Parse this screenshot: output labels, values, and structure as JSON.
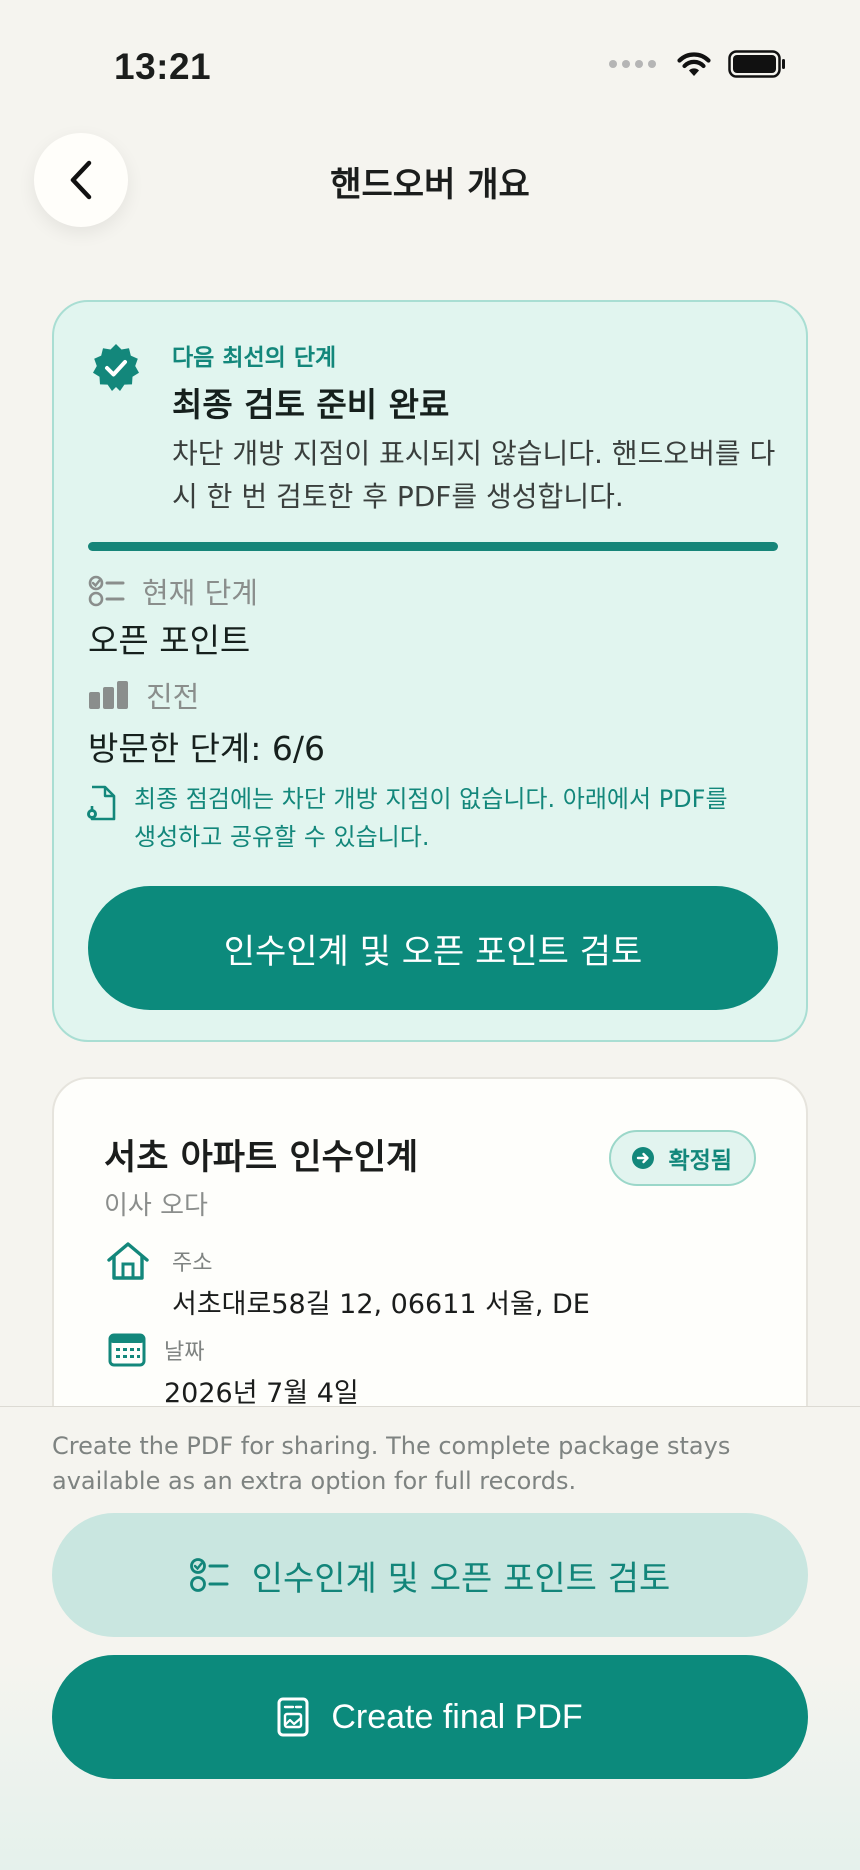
{
  "status_bar": {
    "time": "13:21"
  },
  "header": {
    "title": "핸드오버 개요"
  },
  "next_step": {
    "kicker": "다음 최선의 단계",
    "title": "최종 검토 준비 완료",
    "description": "차단 개방 지점이 표시되지 않습니다. 핸드오버를 다시 한 번 검토한 후 PDF를 생성합니다.",
    "current_stage_label": "현재 단계",
    "current_stage_value": "오픈 포인트",
    "progress_label": "진전",
    "progress_value": "방문한 단계: 6/6",
    "note": "최종 점검에는 차단 개방 지점이 없습니다. 아래에서 PDF를 생성하고 공유할 수 있습니다.",
    "button_label": "인수인계 및 오픈 포인트 검토"
  },
  "project": {
    "title": "서초 아파트 인수인계",
    "subtitle": "이사 오다",
    "status": "확정됨",
    "address_label": "주소",
    "address_value": "서초대로58길 12, 06611 서울, DE",
    "date_label": "날짜",
    "date_value": "2026년 7월 4일"
  },
  "bottom": {
    "hint": "Create the PDF for sharing. The complete package stays available as an extra option for full records.",
    "secondary_label": "인수인계 및 오픈 포인트 검토",
    "primary_label": "Create final PDF"
  },
  "colors": {
    "accent": "#0c8a7c",
    "accent_text": "#13877b",
    "card_tint": "#e1f5ef",
    "background": "#f5f4ef"
  }
}
